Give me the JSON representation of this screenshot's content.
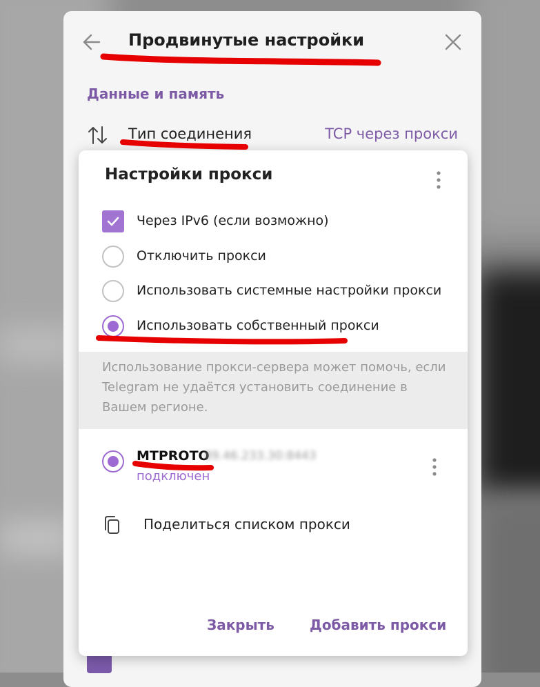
{
  "background_panel": {
    "title": "Продвинутые настройки",
    "section": "Данные и память",
    "connection_type": {
      "label": "Тип соединения",
      "value": "TCP через прокси"
    }
  },
  "dialog": {
    "title": "Настройки прокси",
    "options": [
      {
        "label": "Через IPv6 (если возможно)",
        "control": "checkbox",
        "checked": true
      },
      {
        "label": "Отключить прокси",
        "control": "radio",
        "selected": false
      },
      {
        "label": "Использовать системные настройки прокси",
        "control": "radio",
        "selected": false
      },
      {
        "label": "Использовать собственный прокси",
        "control": "radio",
        "selected": true
      }
    ],
    "info_text": "Использование прокси-сервера может помочь, если Telegram не удаётся установить соединение в Вашем регионе.",
    "proxy": {
      "type": "MTPROTO",
      "address": "89.46.233.30:8443",
      "status": "подключен"
    },
    "share_label": "Поделиться списком прокси",
    "buttons": {
      "close": "Закрыть",
      "add": "Добавить прокси"
    }
  },
  "colors": {
    "accent": "#9c6ad2",
    "accent_text": "#7d5aa6",
    "annotation": "#e60000"
  },
  "icons": {
    "back": "back-arrow-icon",
    "close": "close-icon",
    "connection": "up-down-arrows-icon",
    "menu": "more-vertical-icon",
    "share": "copy-icon"
  }
}
